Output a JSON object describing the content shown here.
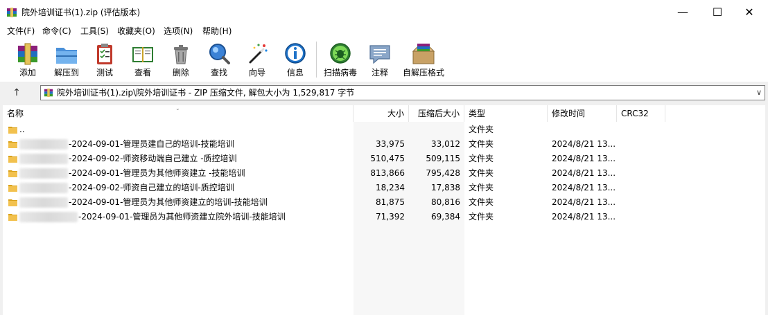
{
  "window": {
    "title": "院外培训证书(1).zip (评估版本)",
    "minimize_glyph": "—",
    "maximize_glyph": "☐",
    "close_glyph": "✕"
  },
  "menu": [
    "文件(F)",
    "命令(C)",
    "工具(S)",
    "收藏夹(O)",
    "选项(N)",
    "帮助(H)"
  ],
  "toolbar": [
    {
      "label": "添加",
      "icon": "add-archive-icon"
    },
    {
      "label": "解压到",
      "icon": "extract-folder-icon"
    },
    {
      "label": "测试",
      "icon": "test-clipboard-icon"
    },
    {
      "label": "查看",
      "icon": "view-book-icon"
    },
    {
      "label": "删除",
      "icon": "trash-icon"
    },
    {
      "label": "查找",
      "icon": "magnifier-icon"
    },
    {
      "label": "向导",
      "icon": "wizard-wand-icon"
    },
    {
      "label": "信息",
      "icon": "info-icon"
    },
    {
      "label": "扫描病毒",
      "icon": "virus-scan-icon"
    },
    {
      "label": "注释",
      "icon": "comment-icon"
    },
    {
      "label": "自解压格式",
      "icon": "sfx-box-icon"
    }
  ],
  "address": {
    "up_glyph": "↑",
    "path": "院外培训证书(1).zip\\院外培训证书 - ZIP 压缩文件, 解包大小为 1,529,817 字节",
    "dropdown_glyph": "∨"
  },
  "columns": {
    "name": "名称",
    "size": "大小",
    "packed": "压缩后大小",
    "type": "类型",
    "modified": "修改时间",
    "crc": "CRC32"
  },
  "rows": [
    {
      "name": "..",
      "size": "",
      "packed": "",
      "type": "文件夹",
      "modified": ""
    },
    {
      "name": "-2024-09-01-管理员建自己的培训-技能培训",
      "size": "33,975",
      "packed": "33,012",
      "type": "文件夹",
      "modified": "2024/8/21 13..."
    },
    {
      "name": "-2024-09-02-师资移动端自己建立 -质控培训",
      "size": "510,475",
      "packed": "509,115",
      "type": "文件夹",
      "modified": "2024/8/21 13..."
    },
    {
      "name": "-2024-09-01-管理员为其他师资建立 -技能培训",
      "size": "813,866",
      "packed": "795,428",
      "type": "文件夹",
      "modified": "2024/8/21 13..."
    },
    {
      "name": "-2024-09-02-师资自己建立的培训-质控培训",
      "size": "18,234",
      "packed": "17,838",
      "type": "文件夹",
      "modified": "2024/8/21 13..."
    },
    {
      "name": "-2024-09-01-管理员为其他师资建立的培训-技能培训",
      "size": "81,875",
      "packed": "80,816",
      "type": "文件夹",
      "modified": "2024/8/21 13..."
    },
    {
      "name": "-2024-09-01-管理员为其他师资建立院外培训-技能培训",
      "size": "71,392",
      "packed": "69,384",
      "type": "文件夹",
      "modified": "2024/8/21 13..."
    }
  ],
  "colors": {
    "folder": "#f2c14e",
    "folder_dark": "#d9a21b",
    "accent_blue": "#1e72c8"
  }
}
